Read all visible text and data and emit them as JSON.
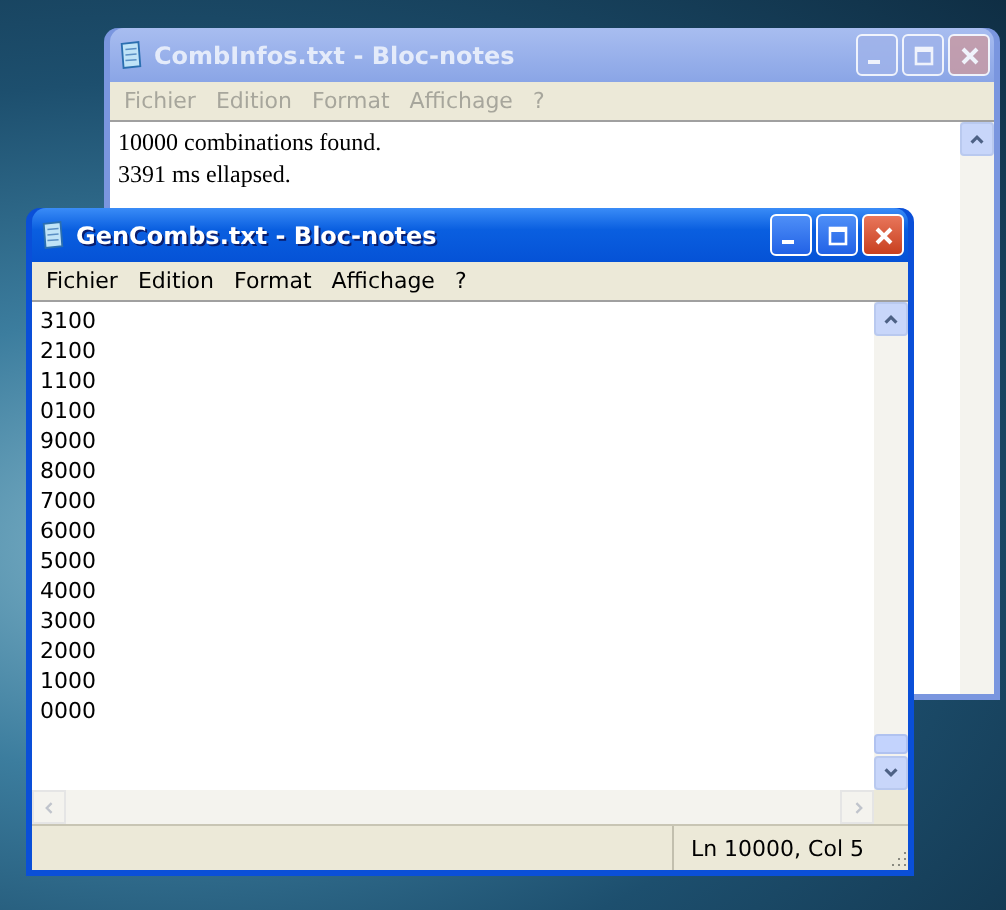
{
  "windows": [
    {
      "title": "CombInfos.txt - Bloc-notes",
      "active": false,
      "menu": [
        "Fichier",
        "Edition",
        "Format",
        "Affichage",
        "?"
      ],
      "lines": [
        "10000 combinations found.",
        "3391 ms ellapsed."
      ]
    },
    {
      "title": "GenCombs.txt - Bloc-notes",
      "active": true,
      "menu": [
        "Fichier",
        "Edition",
        "Format",
        "Affichage",
        "?"
      ],
      "lines": [
        "3100",
        "2100",
        "1100",
        "0100",
        "9000",
        "8000",
        "7000",
        "6000",
        "5000",
        "4000",
        "3000",
        "2000",
        "1000",
        "0000"
      ],
      "status_bar": "Ln 10000, Col 5"
    }
  ]
}
